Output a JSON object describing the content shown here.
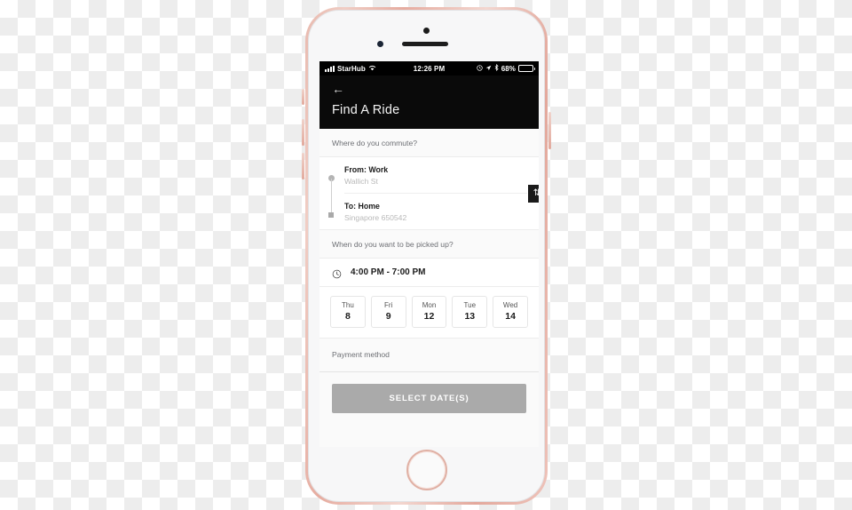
{
  "device": {
    "name": "iphone-rose-gold",
    "home_button": "home-button"
  },
  "status_bar": {
    "carrier": "StarHub",
    "time": "12:26 PM",
    "battery_percent": "68%",
    "icons": [
      "signal-bars-icon",
      "wifi-icon",
      "alarm-icon",
      "location-arrow-icon",
      "bluetooth-icon",
      "battery-icon"
    ]
  },
  "header": {
    "back_icon": "←",
    "title": "Find A Ride"
  },
  "commute": {
    "section_label": "Where do you commute?",
    "from": {
      "title": "From: Work",
      "subtitle": "Wallich St"
    },
    "to": {
      "title": "To: Home",
      "subtitle": "Singapore 650542"
    },
    "swap_icon": "⇅"
  },
  "pickup": {
    "section_label": "When do you want to be picked up?",
    "time_range": "4:00 PM - 7:00 PM",
    "clock_icon": "clock-icon"
  },
  "dates": [
    {
      "dow": "Thu",
      "day": "8"
    },
    {
      "dow": "Fri",
      "day": "9"
    },
    {
      "dow": "Mon",
      "day": "12"
    },
    {
      "dow": "Tue",
      "day": "13"
    },
    {
      "dow": "Wed",
      "day": "14"
    }
  ],
  "payment": {
    "label": "Payment method"
  },
  "cta": {
    "label": "SELECT DATE(S)"
  },
  "colors": {
    "header_bg": "#0a0a0a",
    "cta_bg": "#aaaaaa",
    "frame": "#e6aca0",
    "muted_text": "#b9b9b9"
  }
}
